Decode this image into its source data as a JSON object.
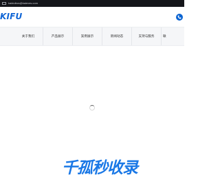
{
  "topbar": {
    "email": "kaiduibcs@kaieves.com"
  },
  "header": {
    "logo_text": "KIFU"
  },
  "nav": {
    "items": [
      "关于我们",
      "产品展示",
      "案例展示",
      "新闻动态",
      "支持与服务",
      "联"
    ]
  },
  "slogan": "千孤秒收录",
  "icons": {
    "mail": "mail-icon",
    "phone": "phone-icon",
    "loader": "loading-spinner-icon"
  },
  "colors": {
    "brand_blue": "#1166d6",
    "topbar_bg": "#14151a",
    "nav_bg": "#f5f6f8"
  }
}
